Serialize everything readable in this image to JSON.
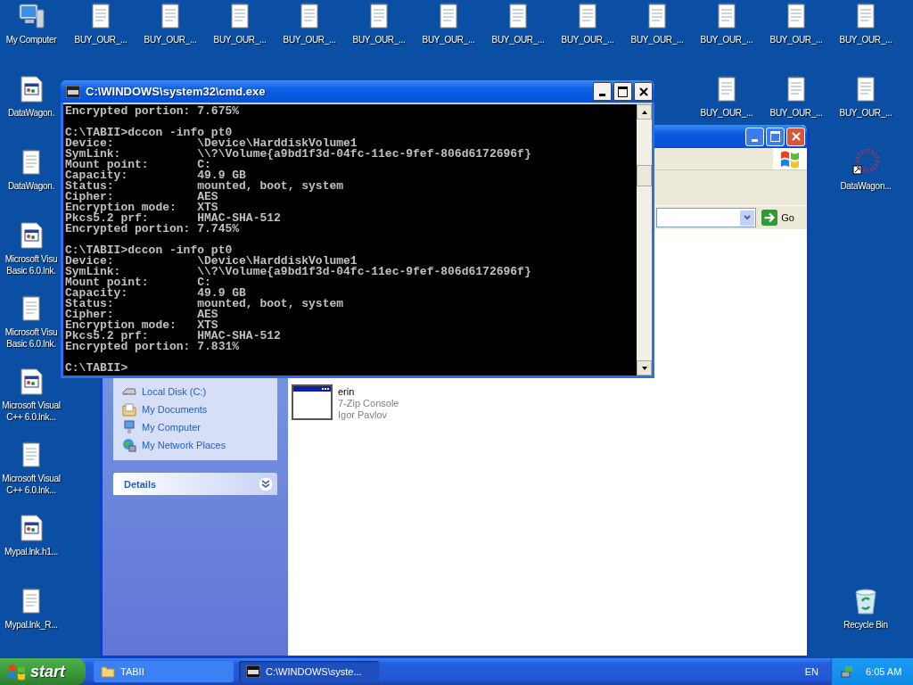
{
  "desktop": {
    "icons": [
      {
        "kind": "computer",
        "label": "My Computer"
      },
      {
        "kind": "document",
        "label": "BUY_OUR_..."
      },
      {
        "kind": "document",
        "label": "BUY_OUR_..."
      },
      {
        "kind": "document",
        "label": "BUY_OUR_..."
      },
      {
        "kind": "document",
        "label": "BUY_OUR_..."
      },
      {
        "kind": "document",
        "label": "BUY_OUR_..."
      },
      {
        "kind": "document",
        "label": "BUY_OUR_..."
      },
      {
        "kind": "document",
        "label": "BUY_OUR_..."
      },
      {
        "kind": "document",
        "label": "BUY_OUR_..."
      },
      {
        "kind": "document",
        "label": "BUY_OUR_..."
      },
      {
        "kind": "document",
        "label": "BUY_OUR_..."
      },
      {
        "kind": "document",
        "label": "BUY_OUR_..."
      },
      {
        "kind": "document",
        "label": "BUY_OUR_..."
      },
      {
        "kind": "program",
        "label": "DataWagon."
      },
      {
        "kind": "document",
        "label": "BUY_OUR_..."
      },
      {
        "kind": "document",
        "label": "BUY_OUR_..."
      },
      {
        "kind": "document",
        "label": "BUY_OUR_..."
      },
      {
        "kind": "document",
        "label": "DataWagon."
      },
      {
        "kind": "shortcut",
        "label": "DataWagon..."
      },
      {
        "kind": "program",
        "label": "Microsoft Visu\nBasic 6.0.lnk."
      },
      {
        "kind": "document",
        "label": "Microsoft Visu\nBasic 6.0.lnk."
      },
      {
        "kind": "program",
        "label": "Microsoft Visual C++ 6.0.lnk..."
      },
      {
        "kind": "document",
        "label": "Microsoft Visual C++ 6.0.lnk..."
      },
      {
        "kind": "program",
        "label": "Mypal.lnk.h1..."
      },
      {
        "kind": "document",
        "label": "Mypal.lnk_R..."
      },
      {
        "kind": "recycle-bin",
        "label": "Recycle Bin"
      }
    ]
  },
  "explorer": {
    "go_button": "Go",
    "other_places": [
      {
        "kind": "drive",
        "label": "Local Disk (C:)"
      },
      {
        "kind": "documents",
        "label": "My Documents"
      },
      {
        "kind": "computer",
        "label": "My Computer"
      },
      {
        "kind": "network",
        "label": "My Network Places"
      }
    ],
    "details": {
      "title": "Details",
      "expanded": false
    },
    "files": [
      {
        "name": "erin",
        "description": "7-Zip Console",
        "company": "Igor Pavlov"
      }
    ]
  },
  "console": {
    "title": "C:\\WINDOWS\\system32\\cmd.exe",
    "blocks": [
      [
        "Encrypted portion: 7.675%"
      ],
      [
        "C:\\TABII>dccon -info pt0",
        "Device:            \\Device\\HarddiskVolume1",
        "SymLink:           \\\\?\\Volume{a9bd1f3d-04fc-11ec-9fef-806d6172696f}",
        "Mount point:       C:",
        "Capacity:          49.9 GB",
        "Status:            mounted, boot, system",
        "Cipher:            AES",
        "Encryption mode:   XTS",
        "Pkcs5.2 prf:       HMAC-SHA-512",
        "Encrypted portion: 7.745%"
      ],
      [
        "C:\\TABII>dccon -info pt0",
        "Device:            \\Device\\HarddiskVolume1",
        "SymLink:           \\\\?\\Volume{a9bd1f3d-04fc-11ec-9fef-806d6172696f}",
        "Mount point:       C:",
        "Capacity:          49.9 GB",
        "Status:            mounted, boot, system",
        "Cipher:            AES",
        "Encryption mode:   XTS",
        "Pkcs5.2 prf:       HMAC-SHA-512",
        "Encrypted portion: 7.831%"
      ],
      [
        "C:\\TABII>"
      ]
    ]
  },
  "taskbar": {
    "start": "start",
    "tasks": [
      {
        "kind": "folder",
        "label": "TABII",
        "selected": false
      },
      {
        "kind": "console",
        "label": "C:\\WINDOWS\\syste...",
        "selected": true
      }
    ],
    "language": "EN",
    "clock": "6:05 AM"
  }
}
